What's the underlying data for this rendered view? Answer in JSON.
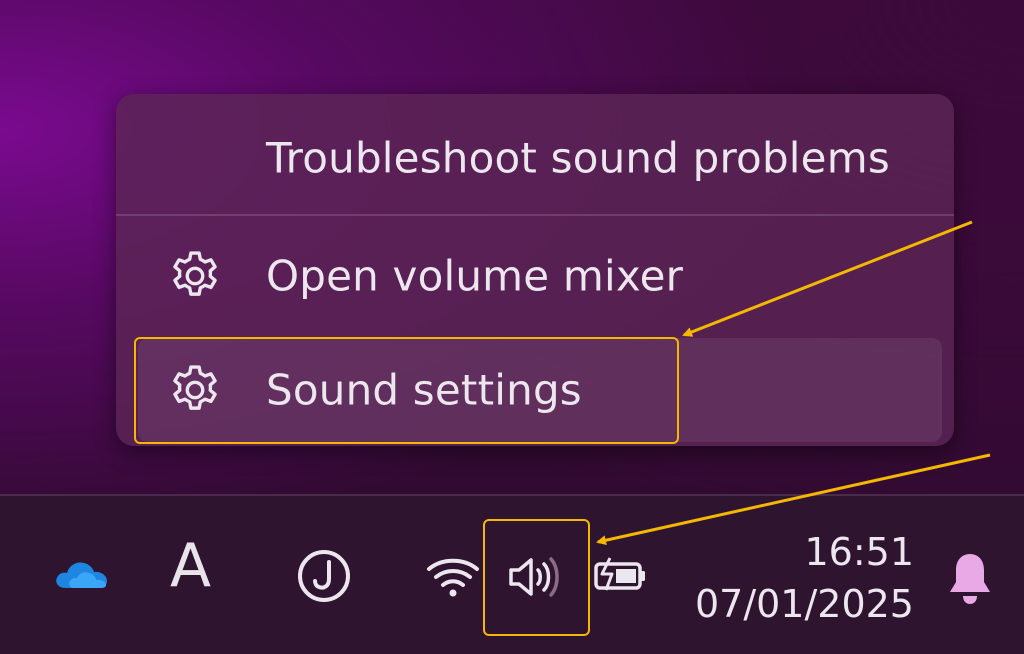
{
  "context_menu": {
    "items": [
      {
        "label": "Troubleshoot sound problems",
        "icon": null
      },
      {
        "label": "Open volume mixer",
        "icon": "gear-icon"
      },
      {
        "label": "Sound settings",
        "icon": "gear-icon"
      }
    ]
  },
  "taskbar": {
    "ime_indicator": "A",
    "clock": {
      "time": "16:51",
      "date": "07/01/2025"
    },
    "tray_icons": [
      "onedrive-icon",
      "ime-indicator",
      "j-icon",
      "wifi-icon",
      "speaker-icon",
      "battery-charging-icon",
      "bell-icon"
    ]
  },
  "colors": {
    "highlight": "#f5b800",
    "menu_text": "#ece6ee",
    "bell": "#e9a8e6"
  }
}
